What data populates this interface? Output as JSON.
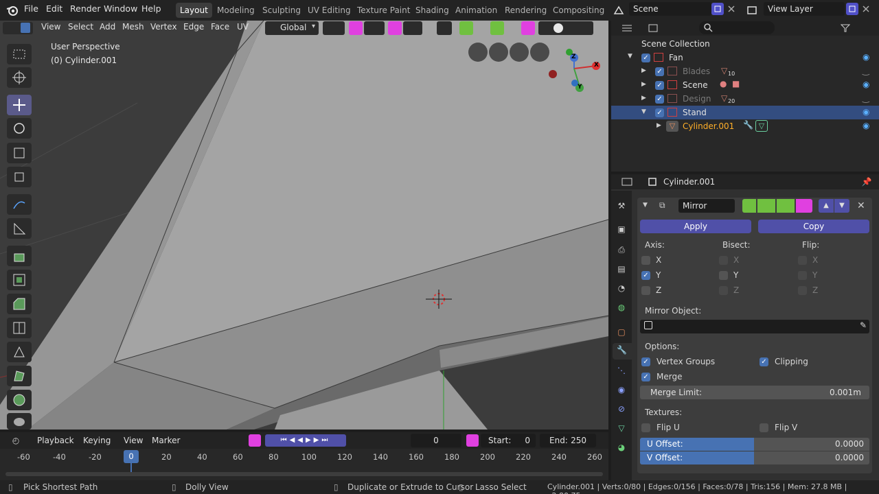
{
  "topbar": {
    "menus": [
      "File",
      "Edit",
      "Render",
      "Window",
      "Help"
    ],
    "workspaces": [
      "Layout",
      "Modeling",
      "Sculpting",
      "UV Editing",
      "Texture Paint",
      "Shading",
      "Animation",
      "Rendering",
      "Compositing"
    ],
    "active_workspace": "Layout",
    "scene": "Scene",
    "view_layer": "View Layer"
  },
  "viewport": {
    "header_menus": [
      "View",
      "Select",
      "Add",
      "Mesh",
      "Vertex",
      "Edge",
      "Face",
      "UV"
    ],
    "orientation": "Global",
    "perspective_label": "User Perspective",
    "object_label": "(0) Cylinder.001",
    "gizmo_axes": [
      "Z",
      "X",
      "Y"
    ]
  },
  "outliner": {
    "search_placeholder": "",
    "root": "Scene Collection",
    "items": [
      {
        "label": "Fan",
        "badge": ""
      },
      {
        "label": "Blades",
        "badge": "10"
      },
      {
        "label": "Scene",
        "badge": ""
      },
      {
        "label": "Design",
        "badge": "20"
      },
      {
        "label": "Stand",
        "badge": ""
      },
      {
        "label": "Cylinder.001",
        "badge": ""
      }
    ]
  },
  "properties": {
    "object_name": "Cylinder.001",
    "modifier_name": "Mirror",
    "apply_label": "Apply",
    "copy_label": "Copy",
    "axis_label": "Axis:",
    "bisect_label": "Bisect:",
    "flip_label": "Flip:",
    "axes": [
      "X",
      "Y",
      "Z"
    ],
    "axis_checked": [
      false,
      true,
      false
    ],
    "bisect_checked": [
      false,
      false,
      false
    ],
    "flip_checked": [
      false,
      false,
      false
    ],
    "mirror_object_label": "Mirror Object:",
    "options_label": "Options:",
    "vertex_groups_label": "Vertex Groups",
    "vertex_groups_checked": true,
    "clipping_label": "Clipping",
    "clipping_checked": true,
    "merge_label": "Merge",
    "merge_checked": true,
    "merge_limit_label": "Merge Limit:",
    "merge_limit_value": "0.001m",
    "textures_label": "Textures:",
    "flip_u_label": "Flip U",
    "flip_v_label": "Flip V",
    "u_offset_label": "U Offset:",
    "u_offset_value": "0.0000",
    "v_offset_label": "V Offset:",
    "v_offset_value": "0.0000"
  },
  "timeline": {
    "menus": [
      "Playback",
      "Keying",
      "View",
      "Marker"
    ],
    "current_frame": "0",
    "start_label": "Start:",
    "start_value": "0",
    "end_label": "End:",
    "end_value": "250",
    "ruler": [
      "-60",
      "-40",
      "-20",
      "0",
      "20",
      "40",
      "60",
      "80",
      "100",
      "120",
      "140",
      "160",
      "180",
      "200",
      "220",
      "240",
      "260"
    ]
  },
  "statusbar": {
    "pick": "Pick Shortest Path",
    "dolly": "Dolly View",
    "duplicate": "Duplicate or Extrude to Cursor",
    "lasso": "Lasso Select",
    "stats": "Cylinder.001 | Verts:0/80 | Edges:0/156 | Faces:0/78 | Tris:156 | Mem: 27.8 MB | v2.80.75"
  },
  "colors": {
    "accent": "#4772b3",
    "button": "#5050a8",
    "selected_row": "#334d80",
    "active_object_text": "#ffaf29"
  }
}
